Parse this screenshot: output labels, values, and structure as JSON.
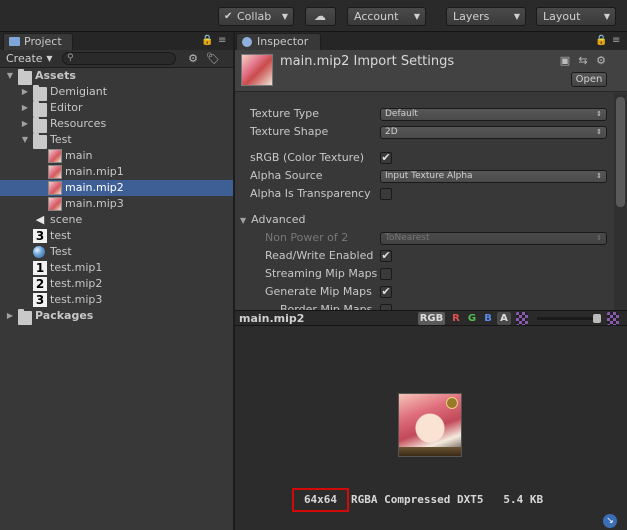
{
  "toolbar": {
    "collab_label": "Collab",
    "account_label": "Account",
    "layers_label": "Layers",
    "layout_label": "Layout",
    "cloud_icon": "cloud-icon",
    "check_icon": "checkmark-icon",
    "dropdown_glyph": "▾"
  },
  "project": {
    "tab_label": "Project",
    "create_label": "Create",
    "search_placeholder": "",
    "tree": [
      {
        "label": "Assets",
        "type": "folder",
        "level": 0,
        "expanded": true,
        "bold": true
      },
      {
        "label": "Demigiant",
        "type": "folder",
        "level": 1,
        "expanded": false
      },
      {
        "label": "Editor",
        "type": "folder",
        "level": 1,
        "expanded": false
      },
      {
        "label": "Resources",
        "type": "folder",
        "level": 1,
        "expanded": false
      },
      {
        "label": "Test",
        "type": "folder",
        "level": 1,
        "expanded": true
      },
      {
        "label": "main",
        "type": "texture",
        "level": 2
      },
      {
        "label": "main.mip1",
        "type": "texture",
        "level": 2
      },
      {
        "label": "main.mip2",
        "type": "texture",
        "level": 2,
        "selected": true
      },
      {
        "label": "main.mip3",
        "type": "texture",
        "level": 2
      },
      {
        "label": "scene",
        "type": "unity-scene",
        "level": 1
      },
      {
        "label": "test",
        "type": "numbered-3",
        "level": 1
      },
      {
        "label": "Test",
        "type": "material-sphere",
        "level": 1
      },
      {
        "label": "test.mip1",
        "type": "numbered-1",
        "level": 1
      },
      {
        "label": "test.mip2",
        "type": "numbered-2",
        "level": 1
      },
      {
        "label": "test.mip3",
        "type": "numbered-3",
        "level": 1
      },
      {
        "label": "Packages",
        "type": "folder",
        "level": 0,
        "expanded": false,
        "bold": true
      }
    ]
  },
  "inspector": {
    "tab_label": "Inspector",
    "title": "main.mip2 Import Settings",
    "open_label": "Open",
    "texture_type_label": "Texture Type",
    "texture_type_value": "Default",
    "texture_shape_label": "Texture Shape",
    "texture_shape_value": "2D",
    "srgb_label": "sRGB (Color Texture)",
    "srgb_checked": true,
    "alpha_source_label": "Alpha Source",
    "alpha_source_value": "Input Texture Alpha",
    "alpha_transparency_label": "Alpha Is Transparency",
    "alpha_transparency_checked": false,
    "advanced_label": "Advanced",
    "npot_label": "Non Power of 2",
    "npot_value": "ToNearest",
    "readwrite_label": "Read/Write Enabled",
    "readwrite_checked": true,
    "streaming_label": "Streaming Mip Maps",
    "streaming_checked": false,
    "genmips_label": "Generate Mip Maps",
    "genmips_checked": true,
    "bordermips_label": "Border Mip Maps"
  },
  "preview": {
    "title": "main.mip2",
    "channel_rgb": "RGB",
    "channel_r": "R",
    "channel_g": "G",
    "channel_b": "B",
    "channel_a": "A",
    "dimensions": "64x64",
    "format": "RGBA Compressed DXT5",
    "size": "5.4 KB",
    "highlight_color": "#d10a0a"
  }
}
